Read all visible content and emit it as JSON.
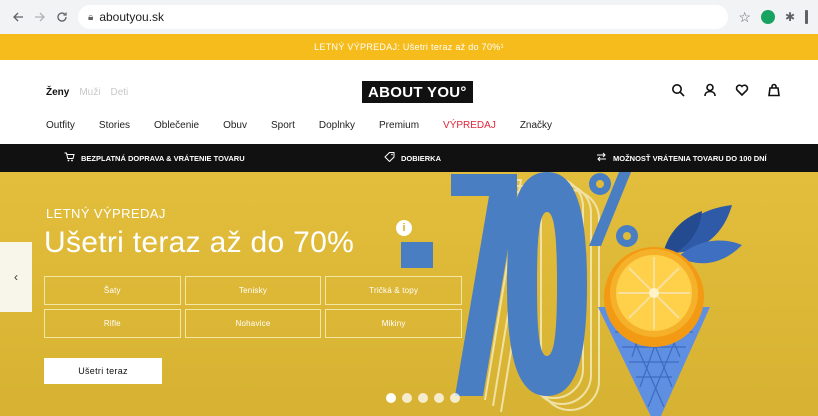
{
  "browser": {
    "url": "aboutyou.sk",
    "icons": {
      "back": "arrow-left-icon",
      "forward": "arrow-right-icon",
      "reload": "reload-icon",
      "lock": "lock-icon",
      "star": "star-icon",
      "extension_1": "green-circle-extension-icon",
      "extension_2": "puzzle-icon",
      "menu": "more-icon"
    }
  },
  "promo": {
    "text": "LETNÝ VÝPREDAJ: Ušetri teraz až do 70%¹"
  },
  "header": {
    "gender": [
      "Ženy",
      "Muži",
      "Deti"
    ],
    "logo": "ABOUT YOU°",
    "icons": [
      "search-icon",
      "user-icon",
      "heart-icon",
      "bag-icon"
    ],
    "nav": [
      "Outfity",
      "Stories",
      "Oblečenie",
      "Obuv",
      "Sport",
      "Doplnky",
      "Premium",
      "VÝPREDAJ",
      "Značky"
    ],
    "sale_color": "#e0253a"
  },
  "infobar": {
    "items": [
      {
        "icon": "cart-icon",
        "label": "BEZPLATNÁ DOPRAVA & VRÁTENIE TOVARU"
      },
      {
        "icon": "tag-icon",
        "label": "DOBIERKA"
      },
      {
        "icon": "exchange-icon",
        "label": "MOŽNOSŤ VRÁTENIA TOVARU DO 100 DNÍ"
      }
    ]
  },
  "hero": {
    "kicker": "LETNÝ VÝPREDAJ",
    "headline": "Ušetri teraz až do 70%",
    "info_icon": "info-icon",
    "grid": [
      "Šaty",
      "Tenisky",
      "Tričká & topy",
      "Rifle",
      "Nohavice",
      "Mikiny"
    ],
    "cta": "Ušetri teraz",
    "promo_graphic": "-70%",
    "slides": 5,
    "active_slide": 0,
    "accent": "#4a7ec3",
    "background": "#ddb73a"
  }
}
